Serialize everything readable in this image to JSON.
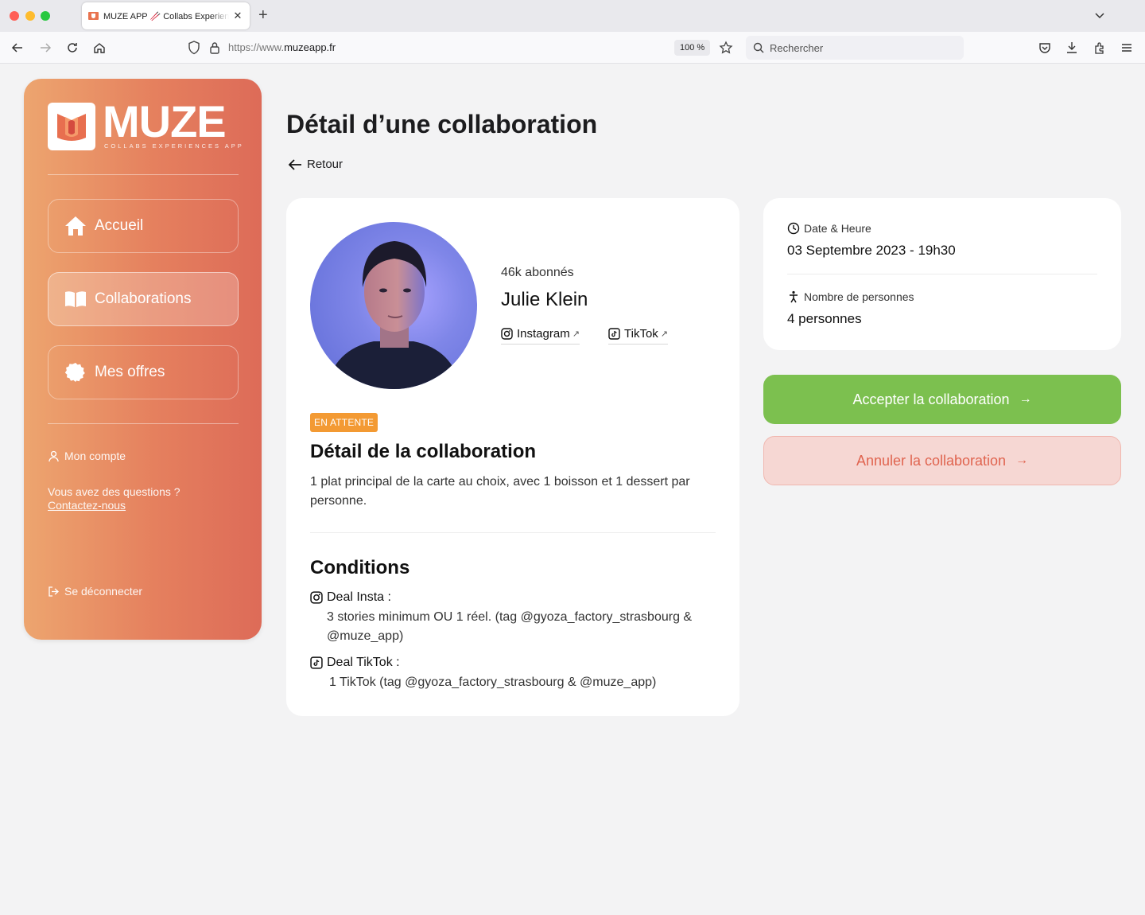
{
  "browser": {
    "tab_title": "MUZE APP 🥢 Collabs Experiences",
    "url_prefix": "https://www.",
    "url_domain": "muzeapp.fr",
    "zoom": "100 %",
    "search_placeholder": "Rechercher"
  },
  "sidebar": {
    "logo_text": "MUZE",
    "logo_sub": "COLLABS EXPERIENCES APP",
    "nav": [
      {
        "label": "Accueil",
        "icon": "home-icon"
      },
      {
        "label": "Collaborations",
        "icon": "book-icon",
        "active": true
      },
      {
        "label": "Mes offres",
        "icon": "badge-icon"
      }
    ],
    "account_label": "Mon compte",
    "help_question": "Vous avez des questions ?",
    "help_link": "Contactez-nous",
    "logout_label": "Se déconnecter"
  },
  "page": {
    "title": "Détail d’une collaboration",
    "back_label": "Retour"
  },
  "influencer": {
    "followers": "46k abonnés",
    "name": "Julie Klein",
    "instagram_label": "Instagram",
    "tiktok_label": "TikTok"
  },
  "collab": {
    "status": "EN ATTENTE",
    "detail_title": "Détail de la collaboration",
    "detail_text": "1 plat principal de la carte au choix, avec 1 boisson et 1 dessert par personne.",
    "conditions_title": "Conditions",
    "insta_deal_label": "Deal Insta :",
    "insta_deal_text": "3 stories minimum OU 1 réel. (tag @gyoza_factory_strasbourg & @muze_app)",
    "tiktok_deal_label": "Deal TikTok :",
    "tiktok_deal_text": "1 TikTok (tag @gyoza_factory_strasbourg & @muze_app)"
  },
  "info": {
    "date_label": "Date & Heure",
    "date_value": "03 Septembre 2023 - 19h30",
    "people_label": "Nombre de personnes",
    "people_value": "4 personnes"
  },
  "actions": {
    "accept_label": "Accepter la collaboration",
    "cancel_label": "Annuler la collaboration",
    "arrow": "→"
  },
  "colors": {
    "accent_green": "#7cc04f",
    "cancel_red": "#e0644f",
    "badge_orange": "#f39a33",
    "sidebar_start": "#eda56f",
    "sidebar_end": "#dd6b58"
  }
}
